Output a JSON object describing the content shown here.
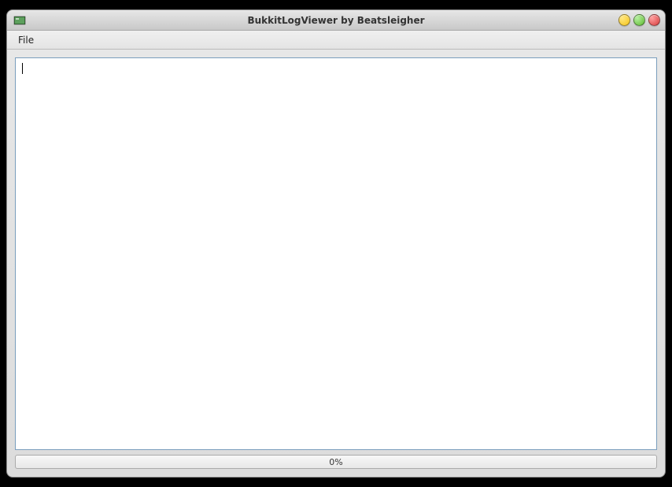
{
  "window": {
    "title": "BukkitLogViewer by Beatsleigher"
  },
  "menubar": {
    "items": [
      {
        "label": "File"
      }
    ]
  },
  "content": {
    "text": ""
  },
  "progress": {
    "label": "0%",
    "value": 0
  }
}
